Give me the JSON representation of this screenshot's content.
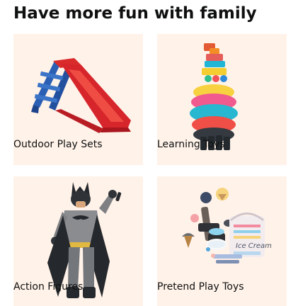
{
  "card": {
    "title": "Have more fun with family",
    "tile_background": "#fff2e9",
    "items": [
      {
        "label": "Outdoor Play Sets",
        "image": "red-slide-icon"
      },
      {
        "label": "Learning Toys",
        "image": "stacking-rings-toy-icon"
      },
      {
        "label": "Action Figures",
        "image": "batman-figure-icon"
      },
      {
        "label": "Pretend Play Toys",
        "image": "ice-cream-play-set-icon"
      }
    ]
  }
}
